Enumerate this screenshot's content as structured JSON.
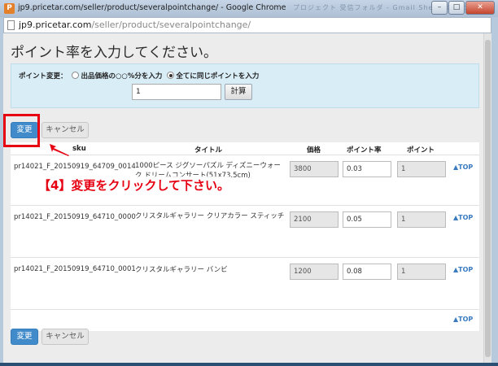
{
  "window": {
    "favicon_letter": "P",
    "title": "jp9.pricetar.com/seller/product/severalpointchange/ - Google Chrome",
    "ghost_tabs": "プロジェクト  受信フォルダ - Gmail  Sheet Response",
    "min_symbol": "–",
    "max_symbol": "□",
    "close_symbol": "✕"
  },
  "address": {
    "host": "jp9.pricetar.com",
    "path": "/seller/product/severalpointchange/"
  },
  "page": {
    "title": "ポイント率を入力してください。"
  },
  "setting": {
    "label": "ポイント変更：",
    "option1": "出品価格の○○%分を入力",
    "option2": "全てに同じポイントを入力",
    "selected": "option2",
    "input_value": "1",
    "calc_label": "計算"
  },
  "actions": {
    "change_label": "変更",
    "cancel_label": "キャンセル"
  },
  "table": {
    "headers": {
      "sku": "sku",
      "title": "タイトル",
      "price": "価格",
      "rate": "ポイント率",
      "point": "ポイント"
    },
    "rows": [
      {
        "sku": "pr14021_F_20150919_64709_0014",
        "title": "1000ピース ジグソーパズル ディズニーウォーク ドリームコンサート(51x73.5cm)",
        "price": "3800",
        "rate": "0.03",
        "point": "1"
      },
      {
        "sku": "pr14021_F_20150919_64710_0000",
        "title": "クリスタルギャラリー クリアカラー スティッチ",
        "price": "2100",
        "rate": "0.05",
        "point": "1"
      },
      {
        "sku": "pr14021_F_20150919_64710_0001",
        "title": "クリスタルギャラリー バンビ",
        "price": "1200",
        "rate": "0.08",
        "point": "1"
      }
    ],
    "top_link": "▲TOP"
  },
  "annotation": {
    "text": "【4】変更をクリックして下さい。",
    "color": "#e60012"
  }
}
